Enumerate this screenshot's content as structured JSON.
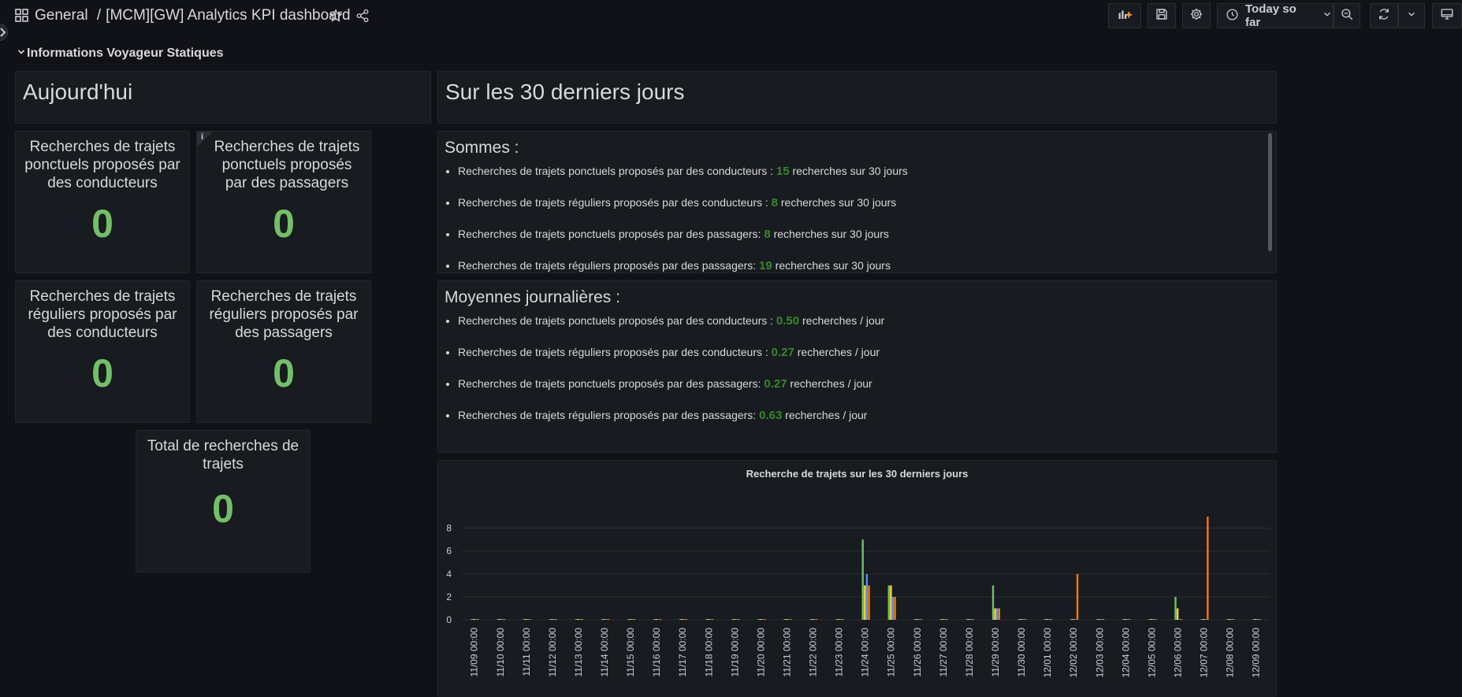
{
  "header": {
    "folder": "General",
    "separator": "/",
    "dashboard_title": "[MCM][GW] Analytics KPI dashboard",
    "time_range_label": "Today so far"
  },
  "row": {
    "title": "Informations Voyageur Statiques"
  },
  "panels": {
    "today_title": "Aujourd'hui",
    "last30_title": "Sur les 30 derniers jours",
    "stats": [
      {
        "title": "Recherches de trajets ponctuels proposés par des conducteurs",
        "value": "0"
      },
      {
        "title": "Recherches de trajets ponctuels proposés par des passagers",
        "value": "0"
      },
      {
        "title": "Recherches de trajets réguliers proposés par des conducteurs",
        "value": "0"
      },
      {
        "title": "Recherches de trajets réguliers proposés par des passagers",
        "value": "0"
      },
      {
        "title": "Total de recherches de trajets",
        "value": "0"
      }
    ],
    "info_icon": "i",
    "sums": {
      "heading": "Sommes :",
      "items": [
        {
          "pre": "Recherches de trajets ponctuels proposés par des conducteurs : ",
          "num": "15",
          "post": " recherches sur 30 jours"
        },
        {
          "pre": "Recherches de trajets réguliers proposés par des conducteurs : ",
          "num": "8",
          "post": " recherches sur 30 jours"
        },
        {
          "pre": "Recherches de trajets ponctuels proposés par des passagers: ",
          "num": "8",
          "post": " recherches sur 30 jours"
        },
        {
          "pre": "Recherches de trajets réguliers proposés par des passagers: ",
          "num": "19",
          "post": " recherches sur 30 jours"
        }
      ]
    },
    "averages": {
      "heading": "Moyennes journalières :",
      "items": [
        {
          "pre": "Recherches de trajets ponctuels proposés par des conducteurs : ",
          "num": "0.50",
          "post": " recherches / jour"
        },
        {
          "pre": "Recherches de trajets réguliers proposés par des conducteurs : ",
          "num": "0.27",
          "post": " recherches / jour"
        },
        {
          "pre": "Recherches de trajets ponctuels proposés par des passagers: ",
          "num": "0.27",
          "post": " recherches / jour"
        },
        {
          "pre": "Recherches de trajets réguliers proposés par des passagers: ",
          "num": "0.63",
          "post": " recherches / jour"
        }
      ]
    }
  },
  "colors": {
    "green": "#73bf69",
    "yellow": "#fade2a",
    "blue": "#5794f2",
    "orange": "#ff780a",
    "value_green": "#37872d"
  },
  "chart_data": {
    "type": "bar",
    "title": "Recherche de trajets sur les 30 derniers jours",
    "xlabel": "",
    "ylabel": "",
    "ylim": [
      0,
      9
    ],
    "yticks": [
      0,
      2,
      4,
      6,
      8
    ],
    "grid": true,
    "categories": [
      "11/09 00:00",
      "11/10 00:00",
      "11/11 00:00",
      "11/12 00:00",
      "11/13 00:00",
      "11/14 00:00",
      "11/15 00:00",
      "11/16 00:00",
      "11/17 00:00",
      "11/18 00:00",
      "11/19 00:00",
      "11/20 00:00",
      "11/21 00:00",
      "11/22 00:00",
      "11/23 00:00",
      "11/24 00:00",
      "11/25 00:00",
      "11/26 00:00",
      "11/27 00:00",
      "11/28 00:00",
      "11/29 00:00",
      "11/30 00:00",
      "12/01 00:00",
      "12/02 00:00",
      "12/03 00:00",
      "12/04 00:00",
      "12/05 00:00",
      "12/06 00:00",
      "12/07 00:00",
      "12/08 00:00",
      "12/09 00:00"
    ],
    "series": [
      {
        "color": "#73bf69",
        "values": [
          0,
          0,
          0,
          0,
          0,
          0,
          0,
          0,
          0,
          0,
          0,
          0,
          0,
          0,
          0,
          7,
          3,
          0,
          0,
          0,
          3,
          0,
          0,
          0,
          0,
          0,
          0,
          2,
          0,
          0,
          0
        ]
      },
      {
        "color": "#fade2a",
        "values": [
          0,
          0,
          0,
          0,
          0,
          0,
          0,
          0,
          0,
          0,
          0,
          0,
          0,
          0,
          0,
          3,
          3,
          0,
          0,
          0,
          1,
          0,
          0,
          0,
          0,
          0,
          0,
          1,
          0,
          0,
          0
        ]
      },
      {
        "color": "#5794f2",
        "values": [
          0,
          0,
          0,
          0,
          0,
          0,
          0,
          0,
          0,
          0,
          0,
          0,
          0,
          0,
          0,
          4,
          2,
          0,
          0,
          0,
          1,
          0,
          0,
          0,
          0,
          0,
          0,
          0,
          0,
          0,
          0
        ]
      },
      {
        "color": "#ff780a",
        "values": [
          0,
          0,
          0,
          0,
          0,
          0,
          0,
          0,
          0,
          0,
          0,
          0,
          0,
          0,
          0,
          3,
          2,
          0,
          0,
          0,
          1,
          0,
          0,
          4,
          0,
          0,
          0,
          0,
          9,
          0,
          0
        ]
      }
    ]
  }
}
